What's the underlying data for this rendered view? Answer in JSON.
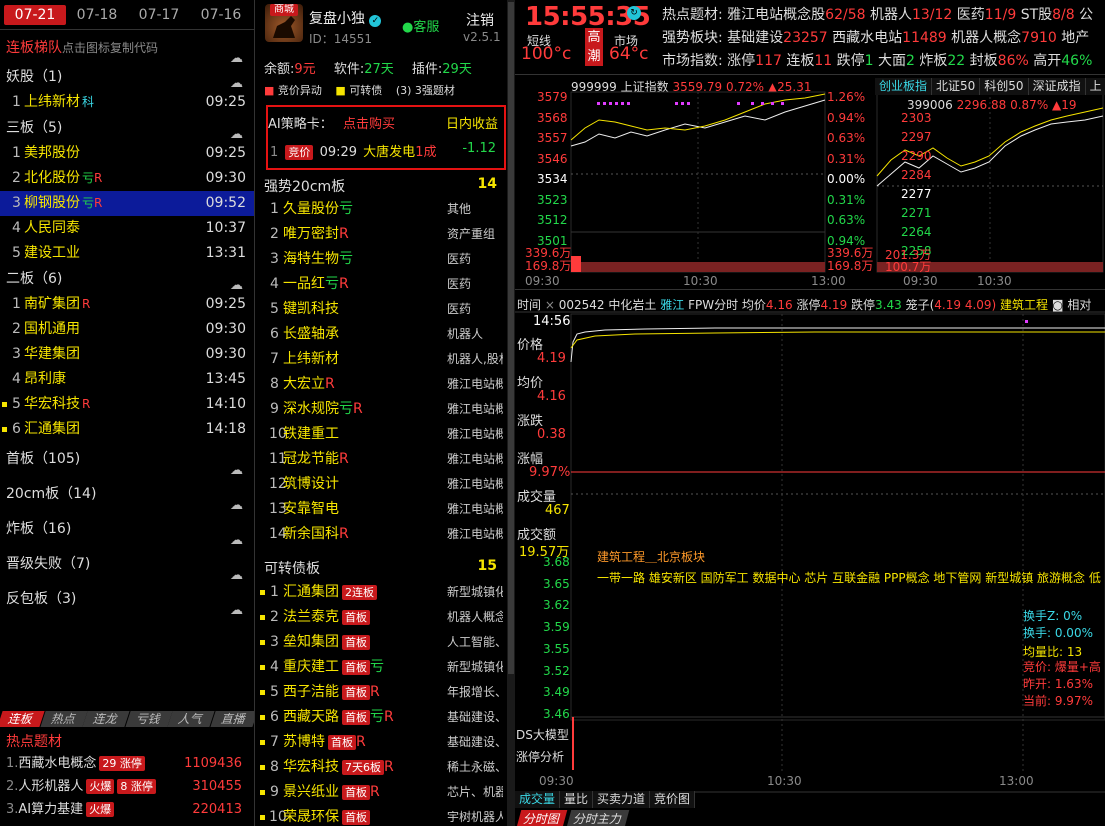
{
  "colors": {
    "accent": "#c8191c",
    "up": "#ff3b3b",
    "down": "#22d84a",
    "highlight": "#f5e400",
    "cyan": "#3ad8e6",
    "selected": "#0c1b9a"
  },
  "left": {
    "date_tabs": [
      "07-21",
      "07-18",
      "07-17",
      "07-16"
    ],
    "title": "连板梯队",
    "subtitle": "点击图标复制代码",
    "groups": [
      {
        "label": "妖股（1)",
        "rows": [
          {
            "n": "1",
            "name": "上纬新材",
            "tag": "科",
            "tagc": "cyan",
            "time": "09:25"
          }
        ]
      },
      {
        "label": "三板（5)",
        "rows": [
          {
            "n": "1",
            "name": "美邦股份",
            "tag": "",
            "time": "09:25"
          },
          {
            "n": "2",
            "name": "北化股份",
            "tag": "亏R",
            "time": "09:30"
          },
          {
            "n": "3",
            "name": "柳钢股份",
            "tag": "亏R",
            "time": "09:52",
            "sel": true
          },
          {
            "n": "4",
            "name": "人民同泰",
            "tag": "",
            "time": "10:37"
          },
          {
            "n": "5",
            "name": "建设工业",
            "tag": "",
            "time": "13:31"
          }
        ]
      },
      {
        "label": "二板（6)",
        "rows": [
          {
            "n": "1",
            "name": "南矿集团",
            "tag": "R",
            "time": "09:25"
          },
          {
            "n": "2",
            "name": "国机通用",
            "tag": "",
            "time": "09:30"
          },
          {
            "n": "3",
            "name": "华建集团",
            "tag": "",
            "time": "09:30"
          },
          {
            "n": "4",
            "name": "昂利康",
            "tag": "",
            "time": "13:45"
          },
          {
            "n": "5",
            "name": "华宏科技",
            "tag": "R",
            "time": "14:10",
            "dot": true
          },
          {
            "n": "6",
            "name": "汇通集团",
            "tag": "",
            "time": "14:18",
            "dot": true
          }
        ]
      }
    ],
    "more_groups": [
      "首板（105)",
      "20cm板（14)",
      "炸板（16)",
      "晋级失败（7)",
      "反包板（3)"
    ],
    "bottom_tabs": [
      "连板",
      "热点",
      "连龙",
      "亏钱",
      "人气",
      "直播"
    ],
    "hot_title": "热点题材",
    "hot": [
      {
        "n": "1.",
        "name": "西藏水电概念",
        "b1": "29 涨停",
        "b2": "",
        "v": "1109436"
      },
      {
        "n": "2.",
        "name": "人形机器人",
        "b1": "火爆",
        "b2": "8 涨停",
        "v": "310455"
      },
      {
        "n": "3.",
        "name": "AI算力基建",
        "b1": "火爆",
        "b2": "",
        "v": "220413"
      }
    ]
  },
  "mid": {
    "shop": "商城",
    "user": "复盘小独",
    "id": "ID：14551",
    "service": "客服",
    "logout": "注销",
    "version": "v2.5.1",
    "balance_lbl": "余额:",
    "balance": "9元",
    "soft_lbl": "软件:",
    "soft": "27天",
    "plugin_lbl": "插件:",
    "plugin": "29天",
    "legend": [
      "竞价异动",
      "可转债",
      "(3) 3强题材"
    ],
    "strategy": {
      "title": "AI策略卡：",
      "buy": "点击购买",
      "income": "日内收益",
      "badge": "竞价",
      "time": "09:29",
      "stock": "大唐发电",
      "pct": "1成",
      "val": "-1.12"
    },
    "sec1": {
      "title": "强势20cm板",
      "count": "14",
      "rows": [
        {
          "n": "1",
          "name": "久量股份",
          "tag": "亏",
          "r": "其他"
        },
        {
          "n": "2",
          "name": "唯万密封",
          "tag": "R",
          "r": "资产重组"
        },
        {
          "n": "3",
          "name": "海特生物",
          "tag": "亏",
          "r": "医药"
        },
        {
          "n": "4",
          "name": "一品红",
          "tag": "亏R",
          "r": "医药"
        },
        {
          "n": "5",
          "name": "键凯科技",
          "tag": "",
          "r": "医药"
        },
        {
          "n": "6",
          "name": "长盛轴承",
          "tag": "",
          "r": "机器人"
        },
        {
          "n": "7",
          "name": "上纬新材",
          "tag": "",
          "r": "机器人,股权"
        },
        {
          "n": "8",
          "name": "大宏立",
          "tag": "R",
          "r": "雅江电站概念"
        },
        {
          "n": "9",
          "name": "深水规院",
          "tag": "亏R",
          "r": "雅江电站概念"
        },
        {
          "n": "10",
          "name": "铁建重工",
          "tag": "",
          "r": "雅江电站概念"
        },
        {
          "n": "11",
          "name": "冠龙节能",
          "tag": "R",
          "r": "雅江电站概念"
        },
        {
          "n": "12",
          "name": "筑博设计",
          "tag": "",
          "r": "雅江电站概念"
        },
        {
          "n": "13",
          "name": "安靠智电",
          "tag": "",
          "r": "雅江电站概念"
        },
        {
          "n": "14",
          "name": "新余国科",
          "tag": "R",
          "r": "雅江电站概念"
        }
      ]
    },
    "sec2": {
      "title": "可转债板",
      "count": "15",
      "rows": [
        {
          "n": "1",
          "name": "汇通集团",
          "b": "2连板",
          "tag": "",
          "r": "新型城镇化"
        },
        {
          "n": "2",
          "name": "法兰泰克",
          "b": "首板",
          "tag": "",
          "r": "机器人概念"
        },
        {
          "n": "3",
          "name": "垒知集团",
          "b": "首板",
          "tag": "",
          "r": "人工智能、"
        },
        {
          "n": "4",
          "name": "重庆建工",
          "b": "首板",
          "tag": "亏",
          "r": "新型城镇化"
        },
        {
          "n": "5",
          "name": "西子洁能",
          "b": "首板",
          "tag": "R",
          "r": "年报增长、"
        },
        {
          "n": "6",
          "name": "西藏天路",
          "b": "首板",
          "tag": "亏R",
          "r": "基础建设、"
        },
        {
          "n": "7",
          "name": "苏博特",
          "b": "首板",
          "tag": "R",
          "r": "基础建设、"
        },
        {
          "n": "8",
          "name": "华宏科技",
          "b": "7天6板",
          "tag": "R",
          "r": "稀土永磁、"
        },
        {
          "n": "9",
          "name": "景兴纸业",
          "b": "首板",
          "tag": "R",
          "r": "芯片、机器人"
        },
        {
          "n": "10",
          "name": "荣晟环保",
          "b": "首板",
          "tag": "",
          "r": "宇树机器人"
        }
      ]
    }
  },
  "right": {
    "time": "15:55:35",
    "short_lbl": "短线",
    "short_val": "100°c",
    "high": "高",
    "tide": "潮",
    "mkt_lbl": "市场",
    "mkt_val": "64°c",
    "l1": {
      "lbl": "热点题材:",
      "items": [
        [
          "雅江电站概念股",
          "62/58"
        ],
        [
          "机器人",
          "13/12"
        ],
        [
          "医药",
          "11/9"
        ],
        [
          "ST股",
          "8/8"
        ],
        [
          "公",
          ""
        ]
      ]
    },
    "l2": {
      "lbl": "强势板块:",
      "items": [
        [
          "基础建设",
          "23257"
        ],
        [
          "西藏水电站",
          "11489"
        ],
        [
          "机器人概念",
          "7910"
        ],
        [
          "地产",
          ""
        ]
      ]
    },
    "l3": {
      "lbl": "市场指数:",
      "items": [
        [
          "涨停",
          "117",
          "red"
        ],
        [
          "连板",
          "11",
          "red"
        ],
        [
          "跌停",
          "1",
          "grn"
        ],
        [
          "大面",
          "2",
          "grn"
        ],
        [
          "炸板",
          "22",
          "grn"
        ],
        [
          "封板",
          "86%",
          "red"
        ],
        [
          "高开",
          "46%",
          "grn"
        ]
      ]
    },
    "idx": {
      "code": "999999",
      "name": "上证指数",
      "price": "3559.79",
      "pct": "0.72%",
      "chg": "▲25.31",
      "yl": [
        "3579",
        "3568",
        "3557",
        "3546",
        "3534",
        "3523",
        "3512",
        "3501"
      ],
      "yr": [
        "1.26%",
        "0.94%",
        "0.63%",
        "0.31%",
        "0.00%",
        "0.31%",
        "0.63%",
        "0.94%"
      ],
      "vol1": "339.6万",
      "vol2": "169.8万",
      "times": [
        "09:30",
        "10:30",
        "13:00"
      ]
    },
    "sec": {
      "tabs": [
        "创业板指",
        "北证50",
        "科创50",
        "深证成指",
        "上"
      ],
      "code": "399006",
      "price": "2296.88",
      "pct": "0.87%",
      "chg": "▲19",
      "yl": [
        "2303",
        "2297",
        "2290",
        "2284",
        "2277",
        "2271",
        "2264",
        "2258"
      ],
      "vol1": "201.3万",
      "vol2": "100.7万",
      "times": [
        "09:30",
        "10:30"
      ]
    },
    "stock": {
      "time_lbl": "时间",
      "code": "002542",
      "name": "中化岩土",
      "tag": "雅江",
      "fpw": "FPW分时",
      "avg_lbl": "均价",
      "avg": "4.16",
      "up_lbl": "涨停",
      "up": "4.19",
      "dn_lbl": "跌停",
      "dn": "3.43",
      "cage_lbl": "笼子(",
      "cage": "4.19 4.09)",
      "ind": "建筑工程",
      "rel": "相对",
      "t": "14:56",
      "price_lbl": "价格",
      "price": "4.19",
      "avgp_lbl": "均价",
      "avgp": "4.16",
      "zd_lbl": "涨跌",
      "zd": "0.38",
      "zf_lbl": "涨幅",
      "zf": "9.97%",
      "vol_lbl": "成交量",
      "vol": "467",
      "amt_lbl": "成交额",
      "amt": "19.57万",
      "ticks": [
        "3.68",
        "3.65",
        "3.62",
        "3.59",
        "3.55",
        "3.52",
        "3.49",
        "3.46"
      ],
      "concept1": "建筑工程＿北京板块",
      "concept2": "一带一路 雄安新区 国防军工 数据中心 芯片 互联金融 PPP概念 地下管网 新型城镇 旅游概念 低",
      "turn_z": "换手Z:  0%",
      "turn": "换手:  0.00%",
      "ratio": "均量比:  13",
      "bid": "竞价: 爆量+高",
      "pre": "昨开: 1.63%",
      "cur": "当前: 9.97%",
      "ds": "DS大模型",
      "zt": "涨停分析",
      "times": [
        "09:30",
        "10:30",
        "13:00"
      ],
      "btabs": [
        "成交量",
        "量比",
        "买卖力道",
        "竞价图"
      ],
      "btabs2": [
        "分时图",
        "分时主力"
      ]
    }
  }
}
